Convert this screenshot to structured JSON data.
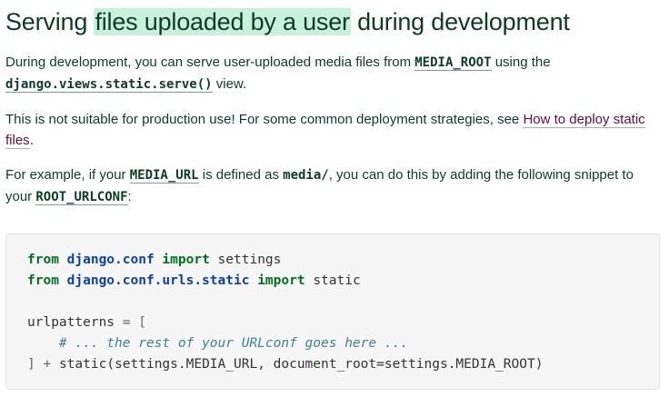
{
  "heading": {
    "before": "Serving ",
    "highlight": "files uploaded by a user",
    "after": " during development"
  },
  "para1": {
    "t1": "During development, you can serve user-uploaded media files from ",
    "code1": "MEDIA_ROOT",
    "t2": " using the ",
    "code2": "django.views.static.serve()",
    "t3": " view."
  },
  "para2": {
    "t1": "This is not suitable for production use! For some common deployment strategies, see ",
    "link": "How to deploy static files",
    "t2": "."
  },
  "para3": {
    "t1": "For example, if your ",
    "code1": "MEDIA_URL",
    "t2": " is defined as ",
    "code2": "media/",
    "t3": ", you can do this by adding the following snippet to your ",
    "code3": "ROOT_URLCONF",
    "t4": ":"
  },
  "code": {
    "l1_kw1": "from",
    "l1_mod": "django.conf",
    "l1_kw2": "import",
    "l1_name": "settings",
    "l2_kw1": "from",
    "l2_mod": "django.conf.urls.static",
    "l2_kw2": "import",
    "l2_name": "static",
    "l4_name": "urlpatterns",
    "l4_op": "=",
    "l4_bracket": "[",
    "l5_comment": "# ... the rest of your URLconf goes here ...",
    "l6_bracket": "]",
    "l6_op": "+",
    "l6_rest": "static(settings.MEDIA_URL, document_root=settings.MEDIA_ROOT)"
  }
}
